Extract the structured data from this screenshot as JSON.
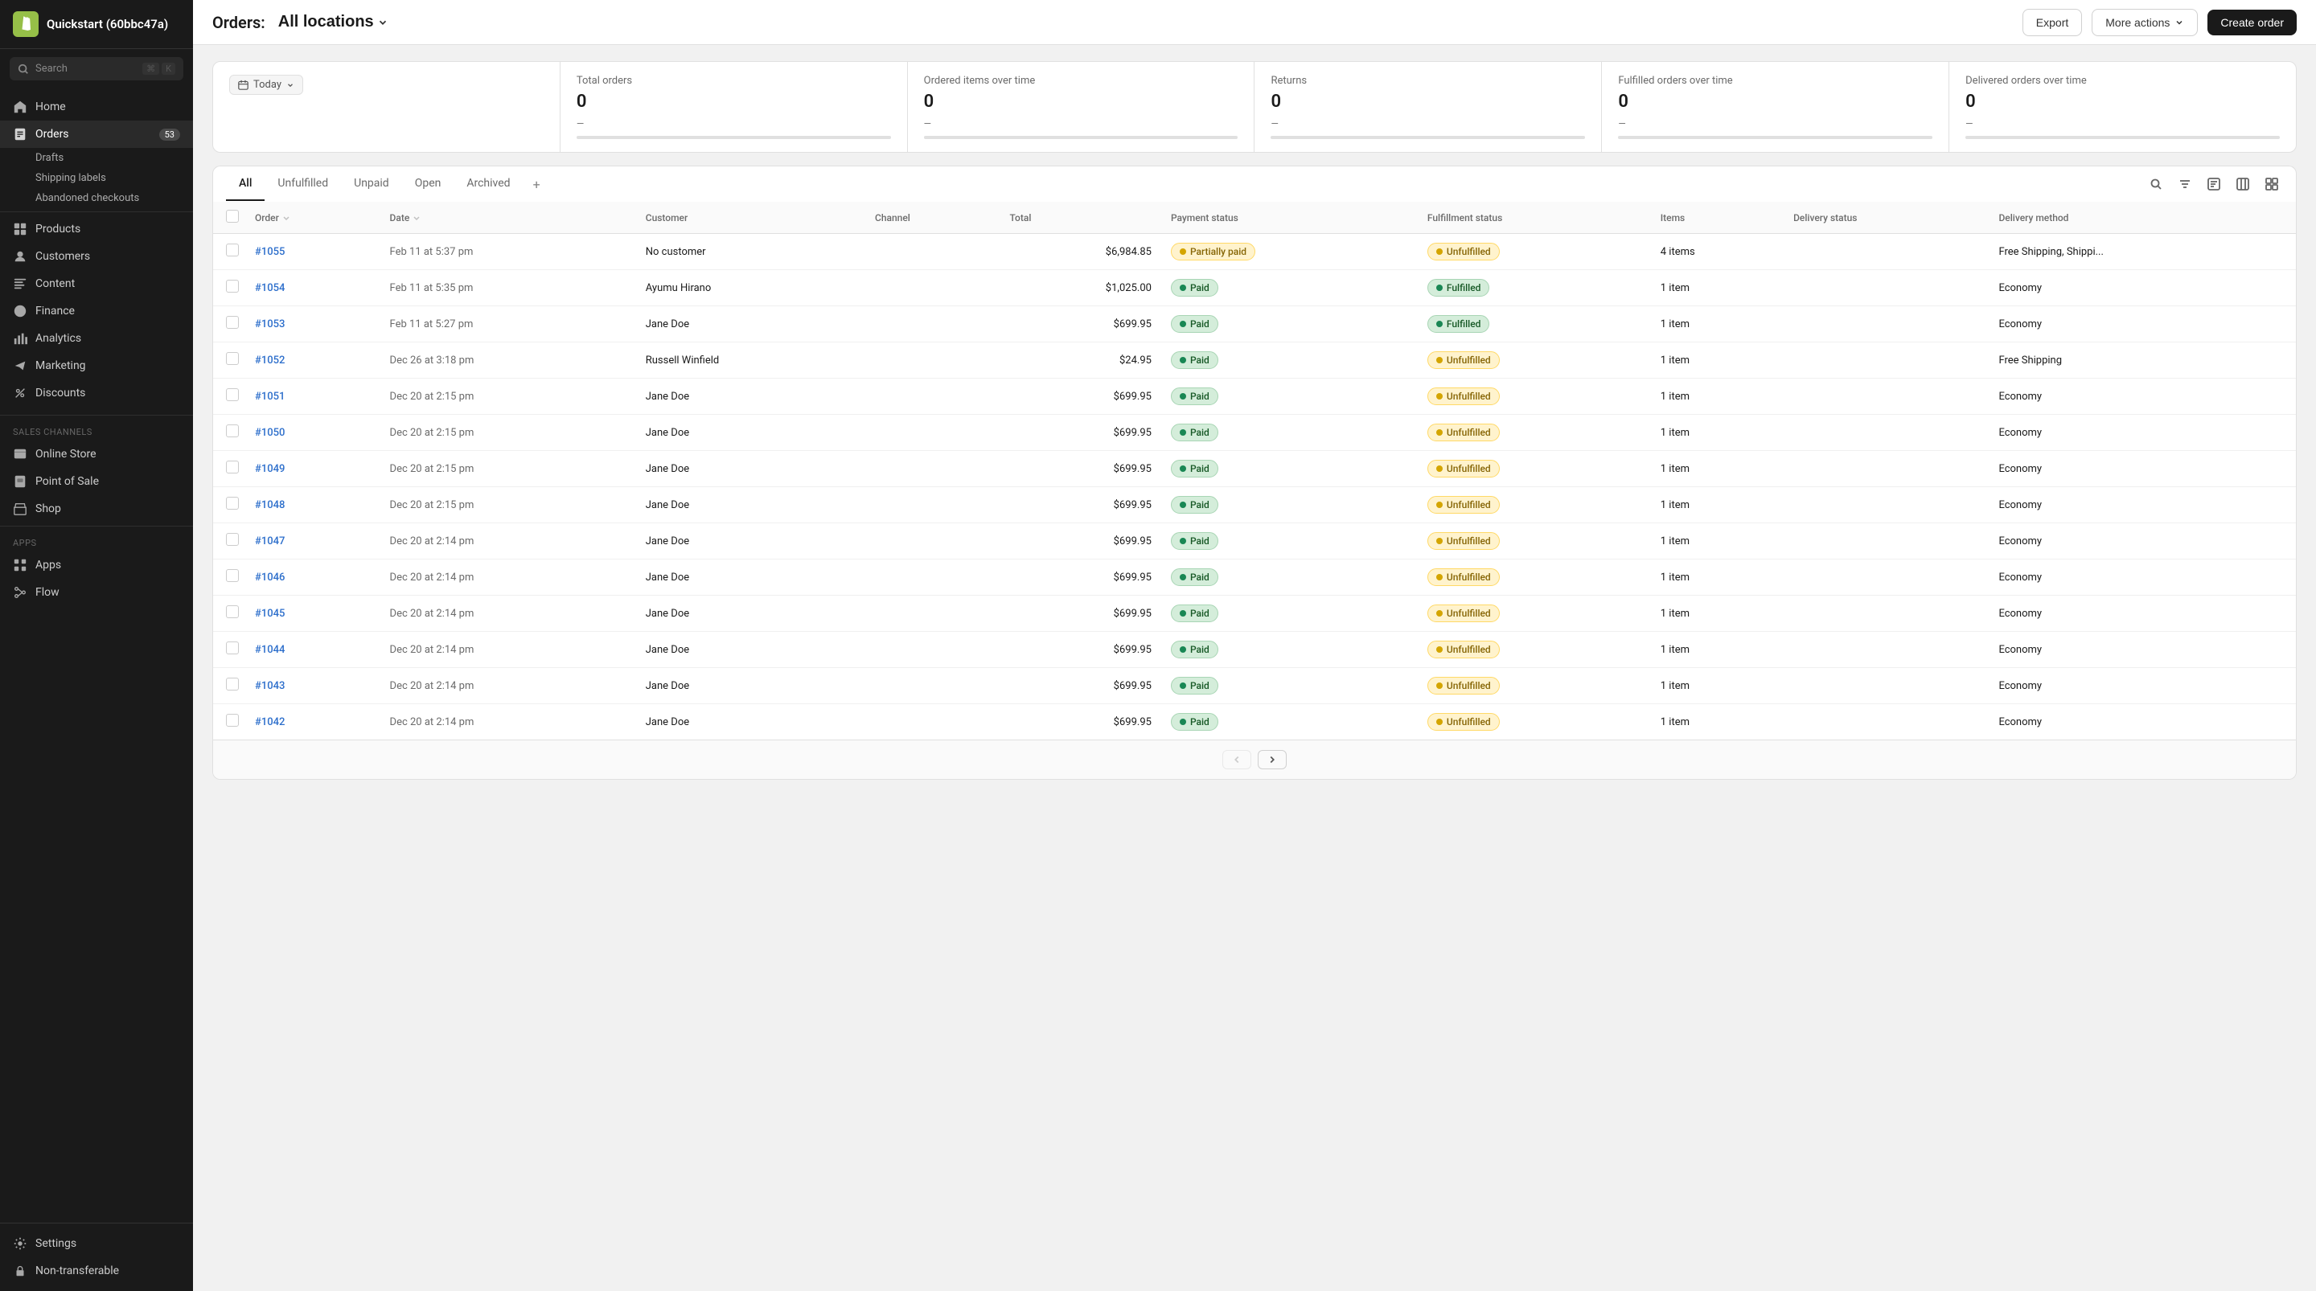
{
  "app": {
    "name": "Shopify",
    "logo_letter": "S",
    "store_name": "Quickstart (60bbc47a)"
  },
  "search": {
    "placeholder": "Search"
  },
  "sidebar": {
    "nav_items": [
      {
        "id": "home",
        "label": "Home",
        "icon": "home-icon",
        "active": false
      },
      {
        "id": "orders",
        "label": "Orders",
        "icon": "orders-icon",
        "active": true,
        "badge": "53"
      },
      {
        "id": "drafts",
        "label": "Drafts",
        "icon": "drafts-icon",
        "active": false,
        "sub": true
      },
      {
        "id": "shipping-labels",
        "label": "Shipping labels",
        "icon": "shipping-labels-icon",
        "active": false,
        "sub": true
      },
      {
        "id": "abandoned-checkouts",
        "label": "Abandoned checkouts",
        "icon": "abandoned-icon",
        "active": false,
        "sub": true
      },
      {
        "id": "products",
        "label": "Products",
        "icon": "products-icon",
        "active": false
      },
      {
        "id": "customers",
        "label": "Customers",
        "icon": "customers-icon",
        "active": false
      },
      {
        "id": "content",
        "label": "Content",
        "icon": "content-icon",
        "active": false
      },
      {
        "id": "finance",
        "label": "Finance",
        "icon": "finance-icon",
        "active": false
      },
      {
        "id": "analytics",
        "label": "Analytics",
        "icon": "analytics-icon",
        "active": false
      },
      {
        "id": "marketing",
        "label": "Marketing",
        "icon": "marketing-icon",
        "active": false
      },
      {
        "id": "discounts",
        "label": "Discounts",
        "icon": "discounts-icon",
        "active": false
      }
    ],
    "sales_channels_label": "Sales channels",
    "sales_channels": [
      {
        "id": "online-store",
        "label": "Online Store",
        "icon": "online-store-icon"
      },
      {
        "id": "point-of-sale",
        "label": "Point of Sale",
        "icon": "pos-icon"
      },
      {
        "id": "shop",
        "label": "Shop",
        "icon": "shop-icon"
      }
    ],
    "apps_label": "Apps",
    "apps": [
      {
        "id": "apps",
        "label": "Apps",
        "icon": "apps-icon"
      },
      {
        "id": "flow",
        "label": "Flow",
        "icon": "flow-icon"
      }
    ],
    "settings_label": "Settings",
    "non_transferable_label": "Non-transferable"
  },
  "topbar": {
    "title": "Orders:",
    "location_label": "All locations",
    "export_label": "Export",
    "more_actions_label": "More actions",
    "create_order_label": "Create order"
  },
  "stats": {
    "today_label": "Today",
    "cards": [
      {
        "label": "Total orders",
        "value": "0",
        "trend": "—"
      },
      {
        "label": "Ordered items over time",
        "value": "0",
        "trend": "—"
      },
      {
        "label": "Returns",
        "value": "0",
        "trend": "—"
      },
      {
        "label": "Fulfilled orders over time",
        "value": "0",
        "trend": "—"
      },
      {
        "label": "Delivered orders over time",
        "value": "0",
        "trend": "—"
      }
    ]
  },
  "tabs": [
    {
      "id": "all",
      "label": "All",
      "active": true
    },
    {
      "id": "unfulfilled",
      "label": "Unfulfilled",
      "active": false
    },
    {
      "id": "unpaid",
      "label": "Unpaid",
      "active": false
    },
    {
      "id": "open",
      "label": "Open",
      "active": false
    },
    {
      "id": "archived",
      "label": "Archived",
      "active": false
    }
  ],
  "table": {
    "columns": [
      {
        "id": "checkbox",
        "label": ""
      },
      {
        "id": "order",
        "label": "Order"
      },
      {
        "id": "date",
        "label": "Date"
      },
      {
        "id": "customer",
        "label": "Customer"
      },
      {
        "id": "channel",
        "label": "Channel"
      },
      {
        "id": "total",
        "label": "Total"
      },
      {
        "id": "payment-status",
        "label": "Payment status"
      },
      {
        "id": "fulfillment-status",
        "label": "Fulfillment status"
      },
      {
        "id": "items",
        "label": "Items"
      },
      {
        "id": "delivery-status",
        "label": "Delivery status"
      },
      {
        "id": "delivery-method",
        "label": "Delivery method"
      }
    ],
    "rows": [
      {
        "order": "#1055",
        "date": "Feb 11 at 5:37 pm",
        "customer": "No customer",
        "channel": "",
        "total": "$6,984.85",
        "payment_status": "Partially paid",
        "payment_badge": "partial",
        "fulfillment_status": "Unfulfilled",
        "fulfillment_badge": "unfulfilled",
        "items": "4 items",
        "delivery_status": "",
        "delivery_method": "Free Shipping, Shippi..."
      },
      {
        "order": "#1054",
        "date": "Feb 11 at 5:35 pm",
        "customer": "Ayumu Hirano",
        "channel": "",
        "total": "$1,025.00",
        "payment_status": "Paid",
        "payment_badge": "paid",
        "fulfillment_status": "Fulfilled",
        "fulfillment_badge": "fulfilled",
        "items": "1 item",
        "delivery_status": "",
        "delivery_method": "Economy"
      },
      {
        "order": "#1053",
        "date": "Feb 11 at 5:27 pm",
        "customer": "Jane Doe",
        "channel": "",
        "total": "$699.95",
        "payment_status": "Paid",
        "payment_badge": "paid",
        "fulfillment_status": "Fulfilled",
        "fulfillment_badge": "fulfilled",
        "items": "1 item",
        "delivery_status": "",
        "delivery_method": "Economy"
      },
      {
        "order": "#1052",
        "date": "Dec 26 at 3:18 pm",
        "customer": "Russell Winfield",
        "channel": "",
        "total": "$24.95",
        "payment_status": "Paid",
        "payment_badge": "paid",
        "fulfillment_status": "Unfulfilled",
        "fulfillment_badge": "unfulfilled",
        "items": "1 item",
        "delivery_status": "",
        "delivery_method": "Free Shipping"
      },
      {
        "order": "#1051",
        "date": "Dec 20 at 2:15 pm",
        "customer": "Jane Doe",
        "channel": "",
        "total": "$699.95",
        "payment_status": "Paid",
        "payment_badge": "paid",
        "fulfillment_status": "Unfulfilled",
        "fulfillment_badge": "unfulfilled",
        "items": "1 item",
        "delivery_status": "",
        "delivery_method": "Economy"
      },
      {
        "order": "#1050",
        "date": "Dec 20 at 2:15 pm",
        "customer": "Jane Doe",
        "channel": "",
        "total": "$699.95",
        "payment_status": "Paid",
        "payment_badge": "paid",
        "fulfillment_status": "Unfulfilled",
        "fulfillment_badge": "unfulfilled",
        "items": "1 item",
        "delivery_status": "",
        "delivery_method": "Economy"
      },
      {
        "order": "#1049",
        "date": "Dec 20 at 2:15 pm",
        "customer": "Jane Doe",
        "channel": "",
        "total": "$699.95",
        "payment_status": "Paid",
        "payment_badge": "paid",
        "fulfillment_status": "Unfulfilled",
        "fulfillment_badge": "unfulfilled",
        "items": "1 item",
        "delivery_status": "",
        "delivery_method": "Economy"
      },
      {
        "order": "#1048",
        "date": "Dec 20 at 2:15 pm",
        "customer": "Jane Doe",
        "channel": "",
        "total": "$699.95",
        "payment_status": "Paid",
        "payment_badge": "paid",
        "fulfillment_status": "Unfulfilled",
        "fulfillment_badge": "unfulfilled",
        "items": "1 item",
        "delivery_status": "",
        "delivery_method": "Economy"
      },
      {
        "order": "#1047",
        "date": "Dec 20 at 2:14 pm",
        "customer": "Jane Doe",
        "channel": "",
        "total": "$699.95",
        "payment_status": "Paid",
        "payment_badge": "paid",
        "fulfillment_status": "Unfulfilled",
        "fulfillment_badge": "unfulfilled",
        "items": "1 item",
        "delivery_status": "",
        "delivery_method": "Economy"
      },
      {
        "order": "#1046",
        "date": "Dec 20 at 2:14 pm",
        "customer": "Jane Doe",
        "channel": "",
        "total": "$699.95",
        "payment_status": "Paid",
        "payment_badge": "paid",
        "fulfillment_status": "Unfulfilled",
        "fulfillment_badge": "unfulfilled",
        "items": "1 item",
        "delivery_status": "",
        "delivery_method": "Economy"
      },
      {
        "order": "#1045",
        "date": "Dec 20 at 2:14 pm",
        "customer": "Jane Doe",
        "channel": "",
        "total": "$699.95",
        "payment_status": "Paid",
        "payment_badge": "paid",
        "fulfillment_status": "Unfulfilled",
        "fulfillment_badge": "unfulfilled",
        "items": "1 item",
        "delivery_status": "",
        "delivery_method": "Economy"
      },
      {
        "order": "#1044",
        "date": "Dec 20 at 2:14 pm",
        "customer": "Jane Doe",
        "channel": "",
        "total": "$699.95",
        "payment_status": "Paid",
        "payment_badge": "paid",
        "fulfillment_status": "Unfulfilled",
        "fulfillment_badge": "unfulfilled",
        "items": "1 item",
        "delivery_status": "",
        "delivery_method": "Economy"
      },
      {
        "order": "#1043",
        "date": "Dec 20 at 2:14 pm",
        "customer": "Jane Doe",
        "channel": "",
        "total": "$699.95",
        "payment_status": "Paid",
        "payment_badge": "paid",
        "fulfillment_status": "Unfulfilled",
        "fulfillment_badge": "unfulfilled",
        "items": "1 item",
        "delivery_status": "",
        "delivery_method": "Economy"
      },
      {
        "order": "#1042",
        "date": "Dec 20 at 2:14 pm",
        "customer": "Jane Doe",
        "channel": "",
        "total": "$699.95",
        "payment_status": "Paid",
        "payment_badge": "paid",
        "fulfillment_status": "Unfulfilled",
        "fulfillment_badge": "unfulfilled",
        "items": "1 item",
        "delivery_status": "",
        "delivery_method": "Economy"
      }
    ]
  },
  "pagination": {
    "prev_label": "‹",
    "next_label": "›"
  }
}
